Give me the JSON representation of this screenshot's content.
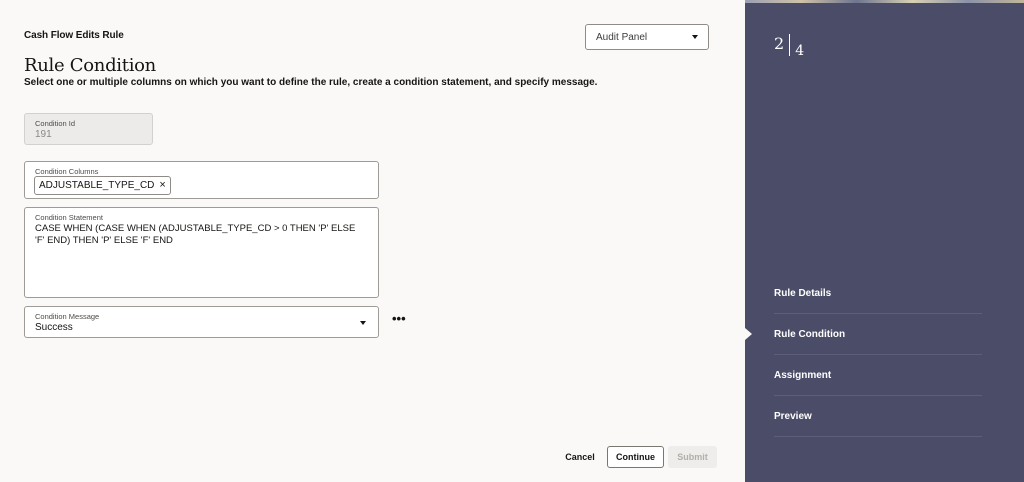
{
  "header": {
    "breadcrumb": "Cash Flow Edits Rule",
    "title": "Rule Condition",
    "subtitle": "Select one or multiple columns on which you want to define the rule, create a condition statement, and specify message."
  },
  "audit_select": {
    "value": "Audit Panel"
  },
  "condition_id": {
    "label": "Condition Id",
    "value": "191"
  },
  "condition_columns": {
    "label": "Condition Columns",
    "chips": [
      "ADJUSTABLE_TYPE_CD"
    ],
    "remove_icon": "close-icon"
  },
  "condition_statement": {
    "label": "Condition Statement",
    "value": "CASE WHEN (CASE WHEN (ADJUSTABLE_TYPE_CD > 0 THEN 'P' ELSE 'F' END) THEN 'P' ELSE 'F' END"
  },
  "condition_message": {
    "label": "Condition Message",
    "value": "Success"
  },
  "more_menu": {
    "label": "•••"
  },
  "footer": {
    "cancel": "Cancel",
    "continue": "Continue",
    "submit": "Submit"
  },
  "train": {
    "current": "2",
    "total": "4",
    "steps": [
      {
        "label": "Rule Details"
      },
      {
        "label": "Rule Condition",
        "active": true
      },
      {
        "label": "Assignment"
      },
      {
        "label": "Preview"
      }
    ]
  },
  "colors": {
    "panel_bg": "#4b4d68",
    "page_bg": "#fbf9f8",
    "disabled_text": "#b2aea9"
  }
}
